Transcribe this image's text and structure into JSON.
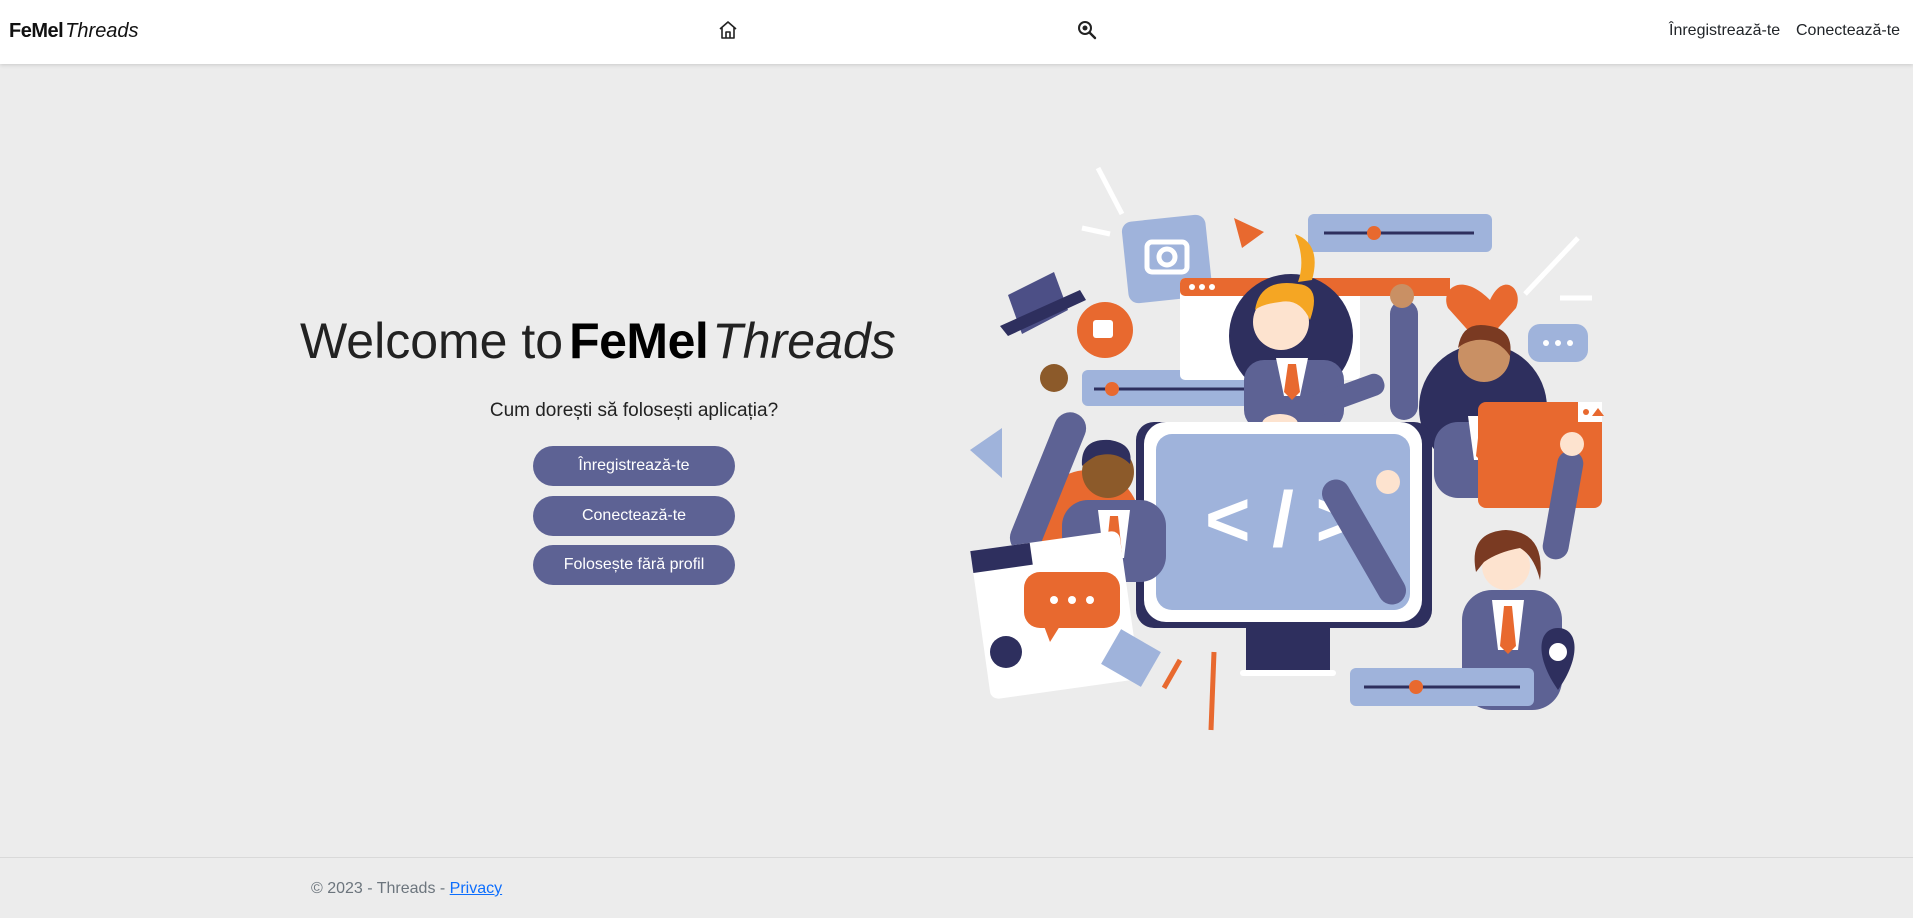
{
  "navbar": {
    "brand_bold": "FeMel",
    "brand_italic": "Threads",
    "home_icon": "home-icon",
    "search_icon": "search-icon",
    "register_link": "Înregistrează-te",
    "login_link": "Conectează-te"
  },
  "hero": {
    "title_prefix": "Welcome to",
    "title_bold": "FeMel",
    "title_italic": "Threads",
    "question": "Cum dorești să folosești aplicația?",
    "buttons": {
      "register": "Înregistrează-te",
      "login": "Conectează-te",
      "guest": "Folosește fără profil"
    }
  },
  "colors": {
    "button_bg": "#5d6294",
    "accent_orange": "#e8692f",
    "accent_blue": "#9fb3db",
    "navy": "#2e2f5e"
  },
  "footer": {
    "copyright": "© 2023 - Threads - ",
    "privacy_link": "Privacy"
  }
}
